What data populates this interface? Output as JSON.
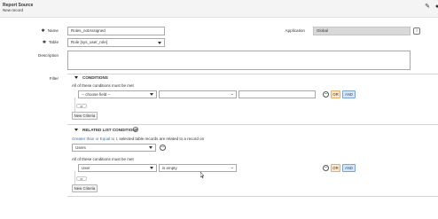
{
  "header": {
    "title": "Report Source",
    "subtitle": "New record"
  },
  "form": {
    "name": {
      "label": "Name",
      "value": "Roles_notAssigned"
    },
    "table": {
      "label": "Table",
      "value": "Role [sys_user_role]"
    },
    "application": {
      "label": "Application",
      "value": "Global"
    },
    "description": {
      "label": "Description",
      "value": ""
    },
    "filter": {
      "label": "Filter"
    }
  },
  "conditions": {
    "title": "CONDITIONS",
    "all_met": "All of these conditions must be met",
    "field_select": "-- choose field --",
    "operator_select": "",
    "value_input": "",
    "or_label": "OR",
    "and_label": "AND",
    "or_pill": "or",
    "new_criteria": "New Criteria"
  },
  "related": {
    "title": "RELATED LIST CONDITIONS",
    "desc_link": "Greater than or Equal to",
    "desc_num": "1",
    "desc_rest": "selected table records are related to a record on",
    "table_select": "Users",
    "all_met": "All of these conditions must be met",
    "field_select": "User",
    "operator_select": "is empty",
    "or_label": "OR",
    "and_label": "AND",
    "or_pill": "or",
    "new_criteria": "New Criteria"
  },
  "colors": {
    "accent_link": "#3a74b8",
    "or_button": "#fde7c6",
    "and_button": "#d9e6f5"
  }
}
